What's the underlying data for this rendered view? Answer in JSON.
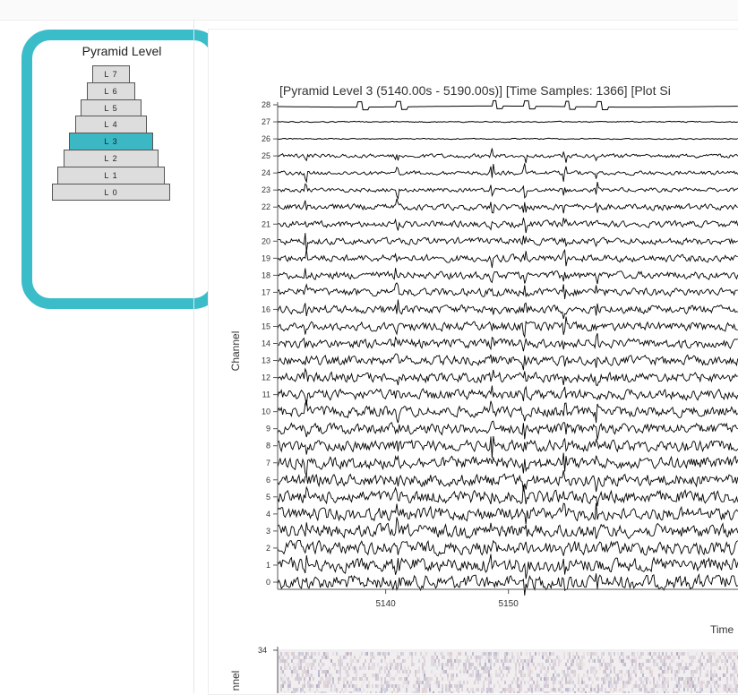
{
  "pyramid": {
    "title": "Pyramid Level",
    "levels": [
      "L 7",
      "L 6",
      "L 5",
      "L 4",
      "L 3",
      "L 2",
      "L 1",
      "L 0"
    ],
    "selected": "L 3"
  },
  "plot": {
    "title": "[Pyramid Level 3 (5140.00s - 5190.00s)]   [Time Samples: 1366]  [Plot Si",
    "ylabel": "Channel",
    "xlabel": "Time",
    "y_ticks": [
      "0",
      "1",
      "2",
      "3",
      "4",
      "5",
      "6",
      "7",
      "8",
      "9",
      "10",
      "11",
      "12",
      "13",
      "14",
      "15",
      "16",
      "17",
      "18",
      "19",
      "20",
      "21",
      "22",
      "23",
      "24",
      "25",
      "26",
      "27",
      "28"
    ],
    "x_ticks": [
      "5140",
      "5150"
    ]
  },
  "heatmap": {
    "ylabel": "nnel",
    "top_tick": "34"
  },
  "colors": {
    "accent": "#3bbdc9",
    "selected_level": "#3bb8c4",
    "trace": "#000000"
  },
  "chart_data": {
    "type": "line",
    "title": "[Pyramid Level 3 (5140.00s - 5190.00s)]   [Time Samples: 1366]  [Plot Si",
    "xlabel": "Time",
    "ylabel": "Channel",
    "xlim": [
      5131.2,
      5168.7
    ],
    "ylim": [
      0,
      28
    ],
    "channels": 29,
    "x_ticks": [
      5140,
      5150
    ]
  }
}
